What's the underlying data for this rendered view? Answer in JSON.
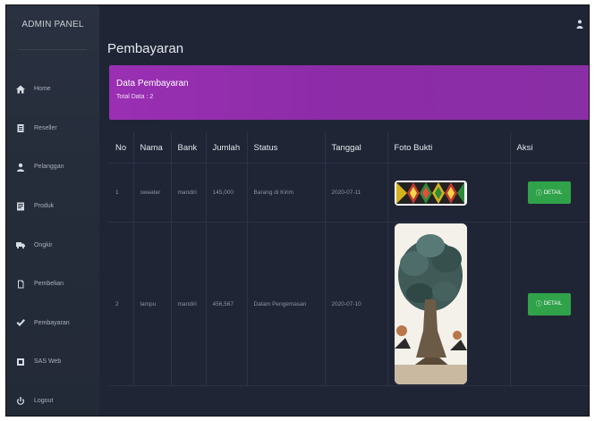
{
  "sidebar": {
    "brand": "ADMIN PANEL",
    "items": [
      {
        "label": "Home",
        "icon": "home-icon"
      },
      {
        "label": "Reseller",
        "icon": "clipboard-icon"
      },
      {
        "label": "Pelanggan",
        "icon": "user-icon"
      },
      {
        "label": "Produk",
        "icon": "book-icon"
      },
      {
        "label": "Ongkir",
        "icon": "truck-icon"
      },
      {
        "label": "Pembelian",
        "icon": "document-icon"
      },
      {
        "label": "Pembayaran",
        "icon": "check-icon"
      },
      {
        "label": "SAS Web",
        "icon": "square-icon"
      },
      {
        "label": "Logout",
        "icon": "power-icon"
      }
    ]
  },
  "header": {
    "title": "Pembayaran"
  },
  "card": {
    "title": "Data Pembayaran",
    "subtitle": "Total Data : 2"
  },
  "table": {
    "columns": [
      "No",
      "Nama",
      "Bank",
      "Jumlah",
      "Status",
      "Tanggal",
      "Foto Bukti",
      "Aksi"
    ],
    "rows": [
      {
        "no": "1",
        "nama": "sweater",
        "bank": "mandiri",
        "jumlah": "145,000",
        "status": "Barang di Kirim",
        "tanggal": "2020-07-11",
        "action": "DETAIL"
      },
      {
        "no": "2",
        "nama": "lampu",
        "bank": "mandiri",
        "jumlah": "456,567",
        "status": "Dalam Pengemasan",
        "tanggal": "2020-07-10",
        "action": "DETAIL"
      }
    ]
  },
  "colors": {
    "accent": "#9a2fb3",
    "button": "#2fa24a",
    "sidebar": "#2a3140",
    "main": "#1f2535"
  }
}
